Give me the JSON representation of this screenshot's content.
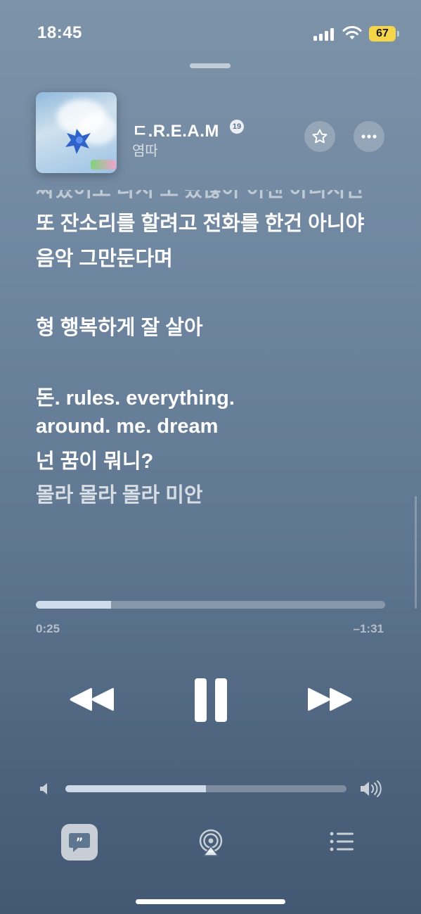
{
  "status_bar": {
    "time": "18:45",
    "battery": "67"
  },
  "now_playing": {
    "title": "ㄷ.R.E.A.M",
    "explicit_badge": "19",
    "artist": "염따"
  },
  "lyrics": [
    {
      "text": "싸웠어도 다시 또 봤잖아 이젠 아니지만",
      "state": "cut"
    },
    {
      "text": "또 잔소리를 할려고 전화를 한건 아니야",
      "state": "active"
    },
    {
      "text": "음악 그만둔다며",
      "state": "active"
    },
    {
      "text": "형 행복하게 잘 살아",
      "state": "active"
    },
    {
      "text": "돈. rules. everything.",
      "state": "active"
    },
    {
      "text": "around. me. dream",
      "state": "active"
    },
    {
      "text": "넌 꿈이 뭐니?",
      "state": "active"
    },
    {
      "text": "몰라 몰라 몰라 미안",
      "state": "dim"
    }
  ],
  "playback": {
    "elapsed": "0:25",
    "remaining": "–1:31",
    "progress_fraction": 0.215,
    "state": "playing"
  },
  "volume": {
    "level_fraction": 0.5
  },
  "colors": {
    "battery_fill": "#f5d64a",
    "background_top": "#7d93a9",
    "background_bottom": "#425873"
  },
  "icons": {
    "star": "star-outline-icon",
    "more": "ellipsis-icon",
    "rewind": "rewind-icon",
    "pause": "pause-icon",
    "forward": "fast-forward-icon",
    "volume_low": "speaker-low-icon",
    "volume_high": "speaker-high-icon",
    "lyrics": "quote-bubble-icon",
    "airplay": "airplay-icon",
    "queue": "list-icon"
  }
}
